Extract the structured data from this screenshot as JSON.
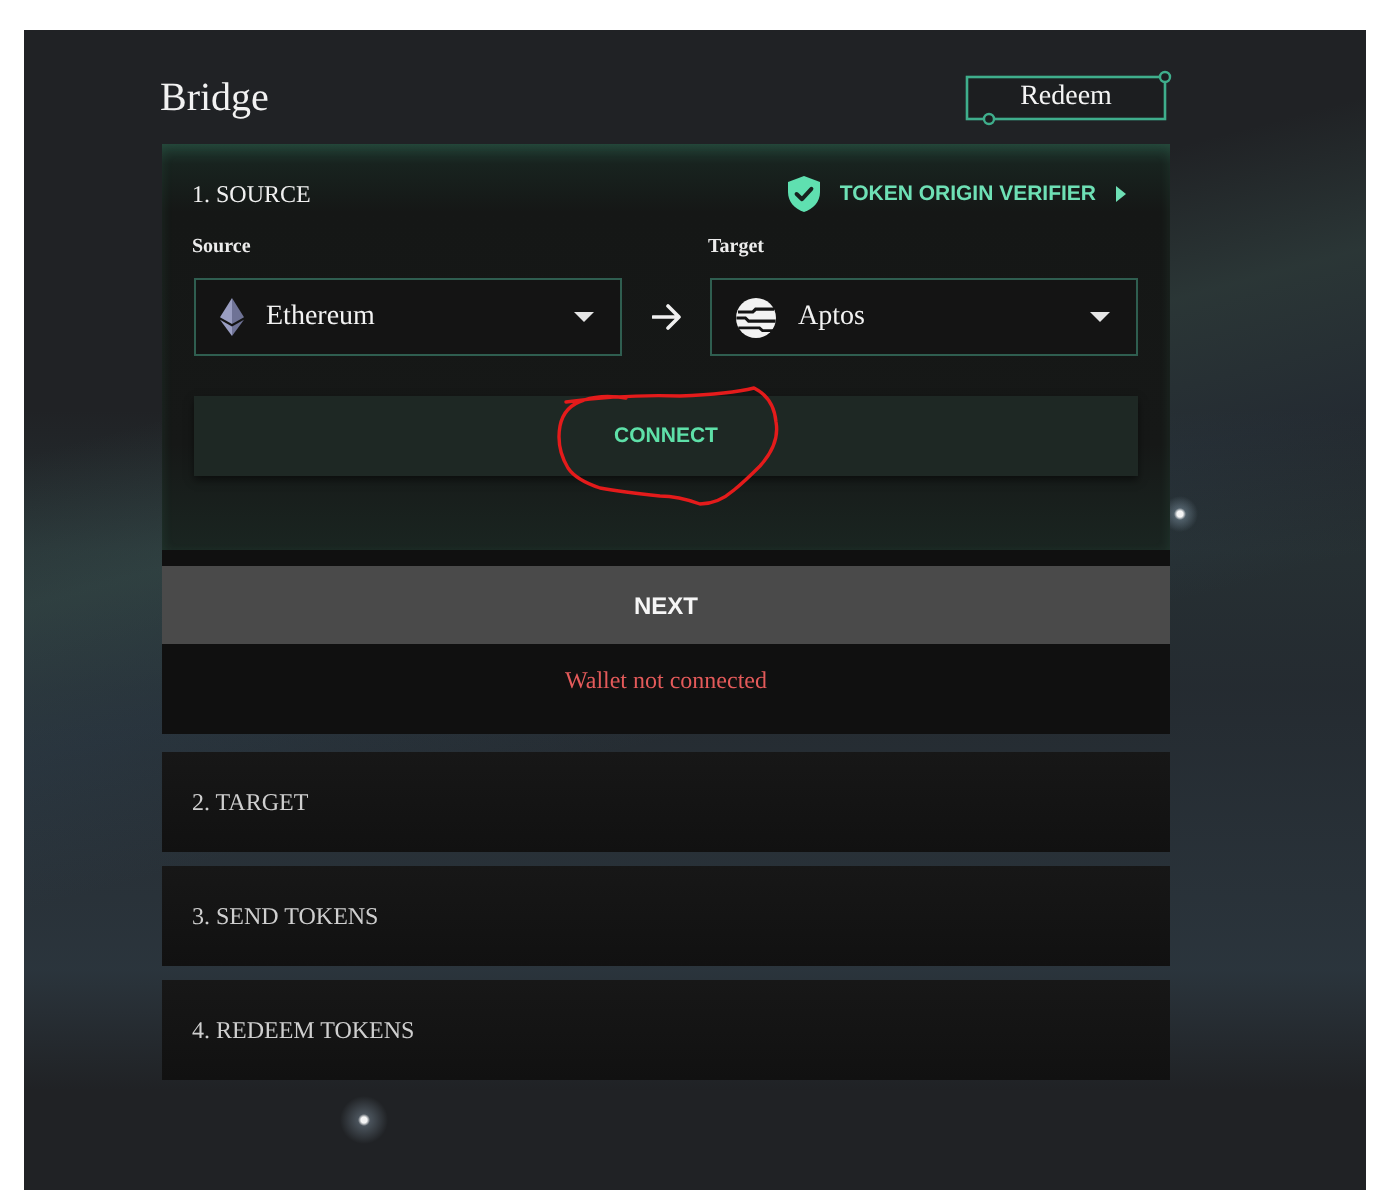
{
  "header": {
    "title": "Bridge",
    "redeem_button": "Redeem"
  },
  "steps": [
    {
      "title": "1. SOURCE",
      "expanded": true,
      "verifier_link": "TOKEN ORIGIN VERIFIER",
      "source": {
        "label": "Source",
        "value": "Ethereum"
      },
      "target": {
        "label": "Target",
        "value": "Aptos"
      },
      "connect_button": "CONNECT",
      "next_button": "NEXT",
      "status": "Wallet not connected"
    },
    {
      "title": "2. TARGET",
      "expanded": false
    },
    {
      "title": "3. SEND TOKENS",
      "expanded": false
    },
    {
      "title": "4. REDEEM TOKENS",
      "expanded": false
    }
  ]
}
